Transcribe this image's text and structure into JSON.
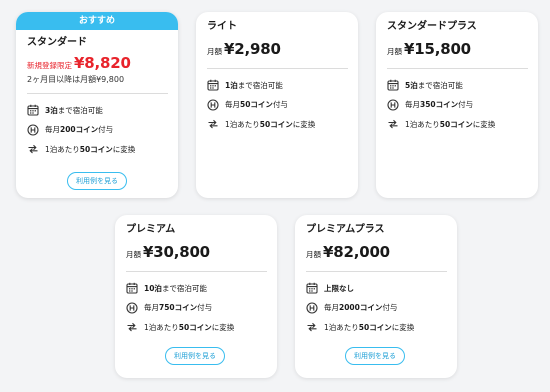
{
  "colors": {
    "accent": "#39bdef",
    "promo": "#e8232b"
  },
  "plans": [
    {
      "ribbon": "おすすめ",
      "name": "スタンダード",
      "price_prefix": "新規登録限定",
      "price": "¥8,820",
      "sub_note": "2ヶ月目以降は月額¥9,800",
      "features": [
        {
          "icon": "calendar-icon",
          "bold": "3泊",
          "text": "まで宿泊可能"
        },
        {
          "icon": "coin-icon",
          "pre": "毎月",
          "bold": "200コイン",
          "text": "付与"
        },
        {
          "icon": "exchange-icon",
          "pre": "1泊あたり",
          "bold": "50コイン",
          "text": "に変換"
        }
      ],
      "button": "利用例を見る"
    },
    {
      "name": "ライト",
      "price_prefix": "月額",
      "price": "¥2,980",
      "features": [
        {
          "icon": "calendar-icon",
          "bold": "1泊",
          "text": "まで宿泊可能"
        },
        {
          "icon": "coin-icon",
          "pre": "毎月",
          "bold": "50コイン",
          "text": "付与"
        },
        {
          "icon": "exchange-icon",
          "pre": "1泊あたり",
          "bold": "50コイン",
          "text": "に変換"
        }
      ]
    },
    {
      "name": "スタンダードプラス",
      "price_prefix": "月額",
      "price": "¥15,800",
      "features": [
        {
          "icon": "calendar-icon",
          "bold": "5泊",
          "text": "まで宿泊可能"
        },
        {
          "icon": "coin-icon",
          "pre": "毎月",
          "bold": "350コイン",
          "text": "付与"
        },
        {
          "icon": "exchange-icon",
          "pre": "1泊あたり",
          "bold": "50コイン",
          "text": "に変換"
        }
      ]
    },
    {
      "name": "プレミアム",
      "price_prefix": "月額",
      "price": "¥30,800",
      "features": [
        {
          "icon": "calendar-icon",
          "bold": "10泊",
          "text": "まで宿泊可能"
        },
        {
          "icon": "coin-icon",
          "pre": "毎月",
          "bold": "750コイン",
          "text": "付与"
        },
        {
          "icon": "exchange-icon",
          "pre": "1泊あたり",
          "bold": "50コイン",
          "text": "に変換"
        }
      ],
      "button": "利用例を見る"
    },
    {
      "name": "プレミアムプラス",
      "price_prefix": "月額",
      "price": "¥82,000",
      "features": [
        {
          "icon": "calendar-icon",
          "bold": "上限なし",
          "text": ""
        },
        {
          "icon": "coin-icon",
          "pre": "毎月",
          "bold": "2000コイン",
          "text": "付与"
        },
        {
          "icon": "exchange-icon",
          "pre": "1泊あたり",
          "bold": "50コイン",
          "text": "に変換"
        }
      ],
      "button": "利用例を見る"
    }
  ]
}
